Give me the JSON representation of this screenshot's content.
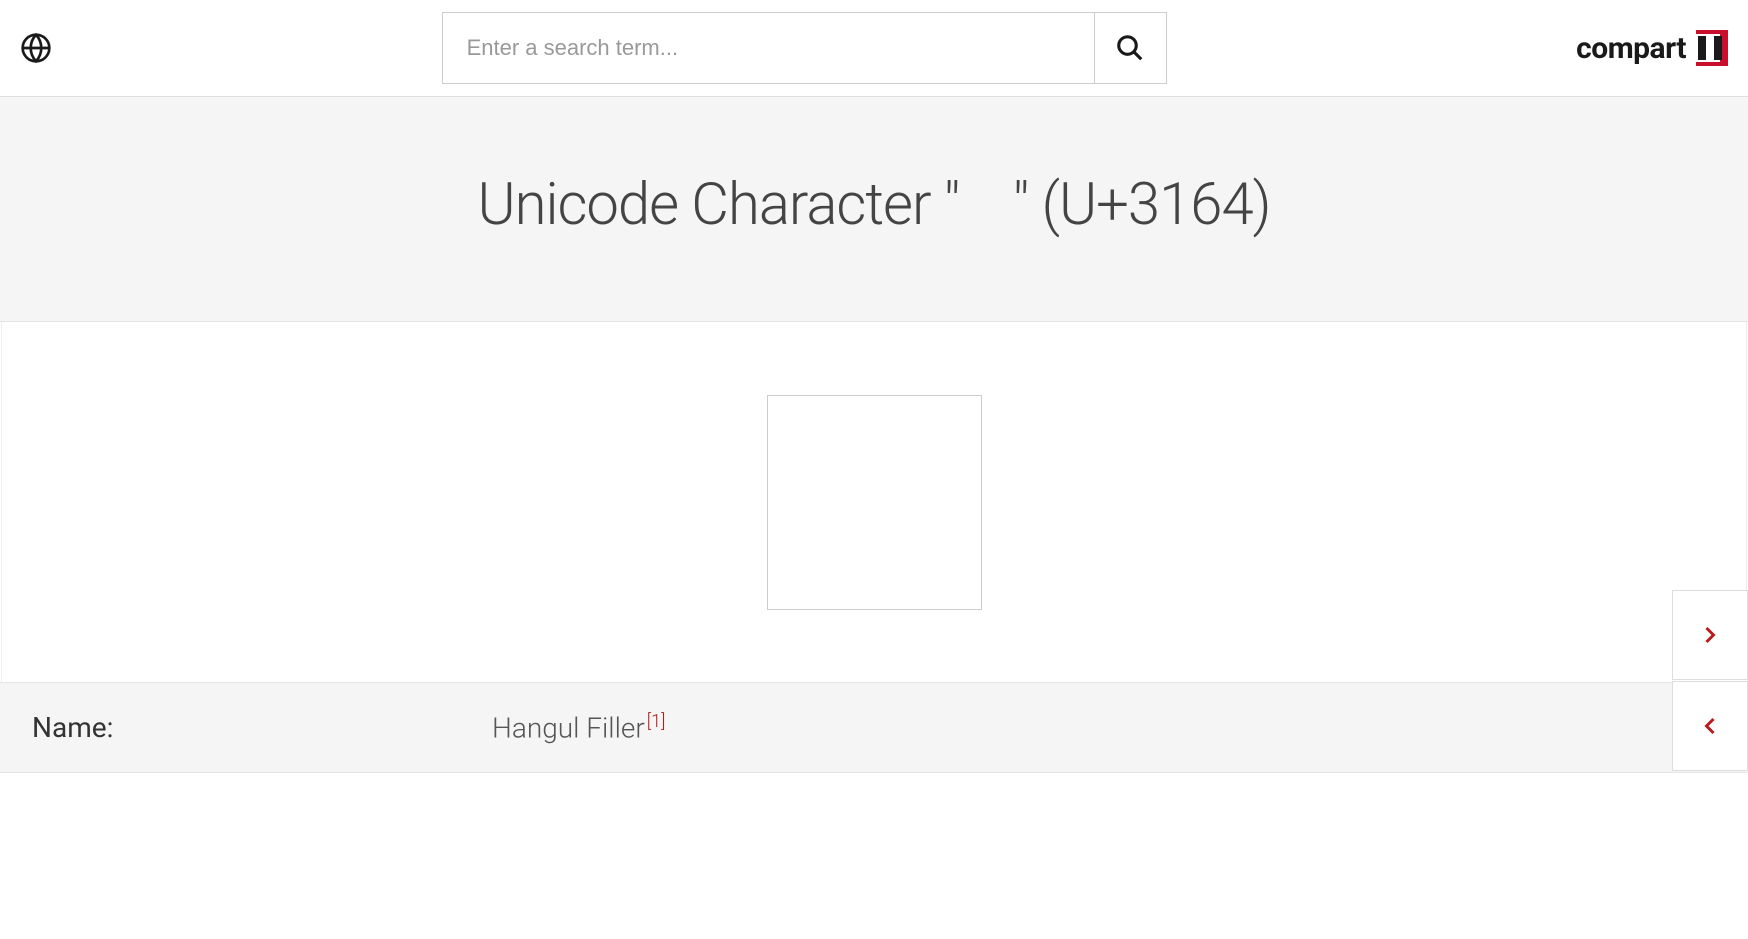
{
  "search": {
    "placeholder": "Enter a search term..."
  },
  "logo": {
    "text": "compart"
  },
  "pageTitle": "Unicode Character \"ㅤ\" (U+3164)",
  "properties": {
    "name": {
      "label": "Name:",
      "value": "Hangul Filler",
      "footnote": "[1]"
    }
  }
}
